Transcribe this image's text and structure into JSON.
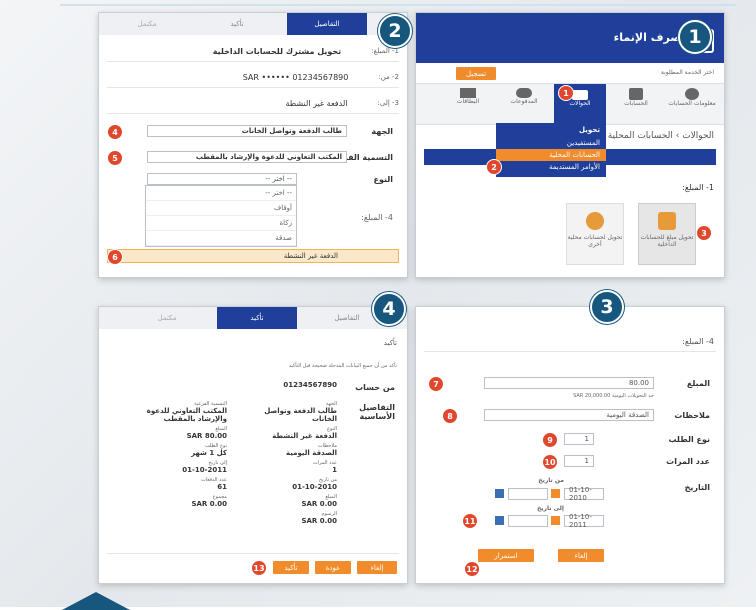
{
  "steps": {
    "s1": "1",
    "s2": "2",
    "s3": "3",
    "s4": "4"
  },
  "badges": {
    "b1": "1",
    "b2": "2",
    "b3": "3",
    "b4": "4",
    "b5": "5",
    "b6": "6",
    "b7": "7",
    "b8": "8",
    "b9": "9",
    "b10": "10",
    "b11": "11",
    "b12": "12",
    "b13": "13"
  },
  "panel1": {
    "brand": "مصرف الإنماء",
    "sub_label": "اختر الخدمة المطلوبة",
    "orange_btn": "تسجيل",
    "tiles": [
      "معلومات الحسابات",
      "الحسابات",
      "الحوالات",
      "المدفوعات",
      "البطاقات"
    ],
    "breadcrumb": "الحوالات › الحسابات المحلية",
    "menu_title": "تحويل",
    "menu_items": [
      "المستفيدين",
      "الحسابات المحلية",
      "الأوامر المستديمة"
    ],
    "details_tab": "التفاصيل",
    "from_label": "1- المبلغ:",
    "card_a": "تحويل مبلغ للحسابات الداخلية",
    "card_b": "تحويل لحسابات محلية أخرى"
  },
  "panel2": {
    "tabs": [
      "التفاصيل",
      "تأكيد",
      "مكتمل"
    ],
    "row1_label": "1- المبلغ:",
    "row1_value": "تحويل مشترك للحسابات الداخلية",
    "row2_label": "2- من:",
    "row2_value": "SAR  ••••••  01234567890",
    "row3_label": "3- إلى:",
    "row3_value": "الدفعة غير النشطة",
    "f_purpose_label": "الجهة",
    "f_purpose_value": "طالب الدفعة وتواصل الخانات",
    "f_category_label": "التسمية الفرعية",
    "f_category_value": "المكتب التعاوني للدعوة والإرشاد بالمقطب",
    "f_type_label": "النوع",
    "f_type_value": "-- اختر --",
    "options": [
      "-- اختر --",
      "أوقاف",
      "زكاة",
      "صدقة",
      "الدفعة غير النشطة"
    ],
    "amount_label": "4- المبلغ:"
  },
  "panel3": {
    "section": "4- المبلغ:",
    "amount_label": "المبلغ",
    "amount_value": "80.00",
    "amount_hint": "حد التحويلات اليومية SAR 20,000.00",
    "notes_label": "ملاحظات",
    "notes_value": "الصدقة اليومية",
    "order_label": "نوع الطلب",
    "order_value": "1",
    "repeat_label": "عدد المرات",
    "repeat_value": "1",
    "date_label": "التاريخ",
    "from_label": "من تاريخ",
    "to_label": "إلى تاريخ",
    "from_date": "01-10-2010",
    "to_date": "01-10-2011",
    "cancel": "إلغاء",
    "next": "استمرار"
  },
  "panel4": {
    "tabs": [
      "التفاصيل",
      "تأكيد",
      "مكتمل"
    ],
    "confirm_title": "تأكيد",
    "note": "تأكد من أن جميع البيانات المدخلة صحيحة قبل التأكيد",
    "from_label": "من حساب",
    "from_value": "01234567890",
    "details_label": "التفاصيل الأساسية",
    "col_right": [
      {
        "k": "الجهة",
        "v": "طالب الدفعة وتواصل الخانات"
      },
      {
        "k": "النوع",
        "v": "الدفعة غير النشطة"
      },
      {
        "k": "ملاحظات",
        "v": "الصدقة اليومية"
      },
      {
        "k": "عدد المرات",
        "v": "1"
      },
      {
        "k": "من تاريخ",
        "v": "01-10-2010"
      },
      {
        "k": "المبلغ",
        "v": "SAR 0.00"
      },
      {
        "k": "الرسوم",
        "v": "SAR 0.00"
      }
    ],
    "col_left": [
      {
        "k": "التسمية الفرعية",
        "v": "المكتب التعاوني للدعوة والإرشاد بالمقطب"
      },
      {
        "k": "المبلغ",
        "v": "SAR 80.00"
      },
      {
        "k": "نوع الطلب",
        "v": "كل 1 شهر"
      },
      {
        "k": "إلى تاريخ",
        "v": "01-10-2011"
      },
      {
        "k": "عدد الدفعات",
        "v": "61"
      },
      {
        "k": "مجموع",
        "v": "SAR 0.00"
      }
    ],
    "btn_confirm": "تأكيد",
    "btn_back": "عودة",
    "btn_cancel": "إلغاء"
  }
}
